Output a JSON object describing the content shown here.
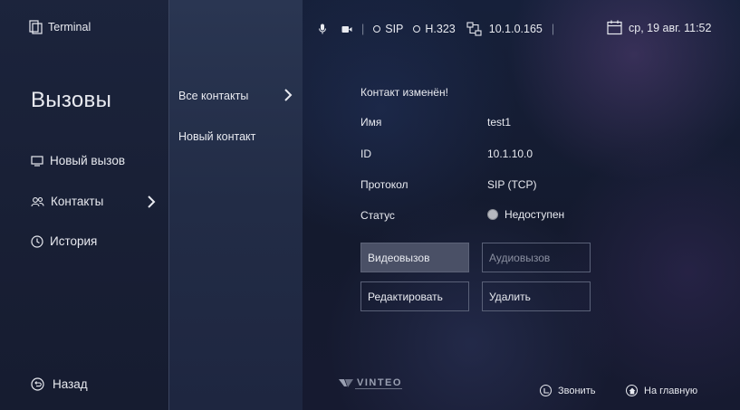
{
  "app": {
    "title": "Terminal"
  },
  "sidebar": {
    "heading": "Вызовы",
    "items": [
      {
        "label": "Новый вызов",
        "icon": "monitor-icon"
      },
      {
        "label": "Контакты",
        "icon": "contacts-icon"
      },
      {
        "label": "История",
        "icon": "clock-icon"
      }
    ],
    "back_label": "Назад"
  },
  "submenu": {
    "items": [
      {
        "label": "Все контакты"
      },
      {
        "label": "Новый контакт"
      }
    ]
  },
  "status_bar": {
    "sip": "SIP",
    "h323": "H.323",
    "ip": "10.1.0.165",
    "datetime": "ср, 19 авг. 11:52"
  },
  "contact": {
    "message": "Контакт изменён!",
    "fields": [
      {
        "label": "Имя",
        "value": "test1"
      },
      {
        "label": "ID",
        "value": "10.1.10.0"
      },
      {
        "label": "Протокол",
        "value": "SIP (TCP)"
      },
      {
        "label": "Статус",
        "value": "Недоступен"
      }
    ],
    "buttons": {
      "video": "Видеовызов",
      "audio": "Аудиовызов",
      "edit": "Редактировать",
      "delete": "Удалить"
    }
  },
  "brand": {
    "logo_text": "VINTEO"
  },
  "footer": {
    "call_label": "Звонить",
    "home_label": "На главную"
  },
  "colors": {
    "status_unavailable": "#b6b8bf",
    "primary_button": "#4a5066"
  }
}
